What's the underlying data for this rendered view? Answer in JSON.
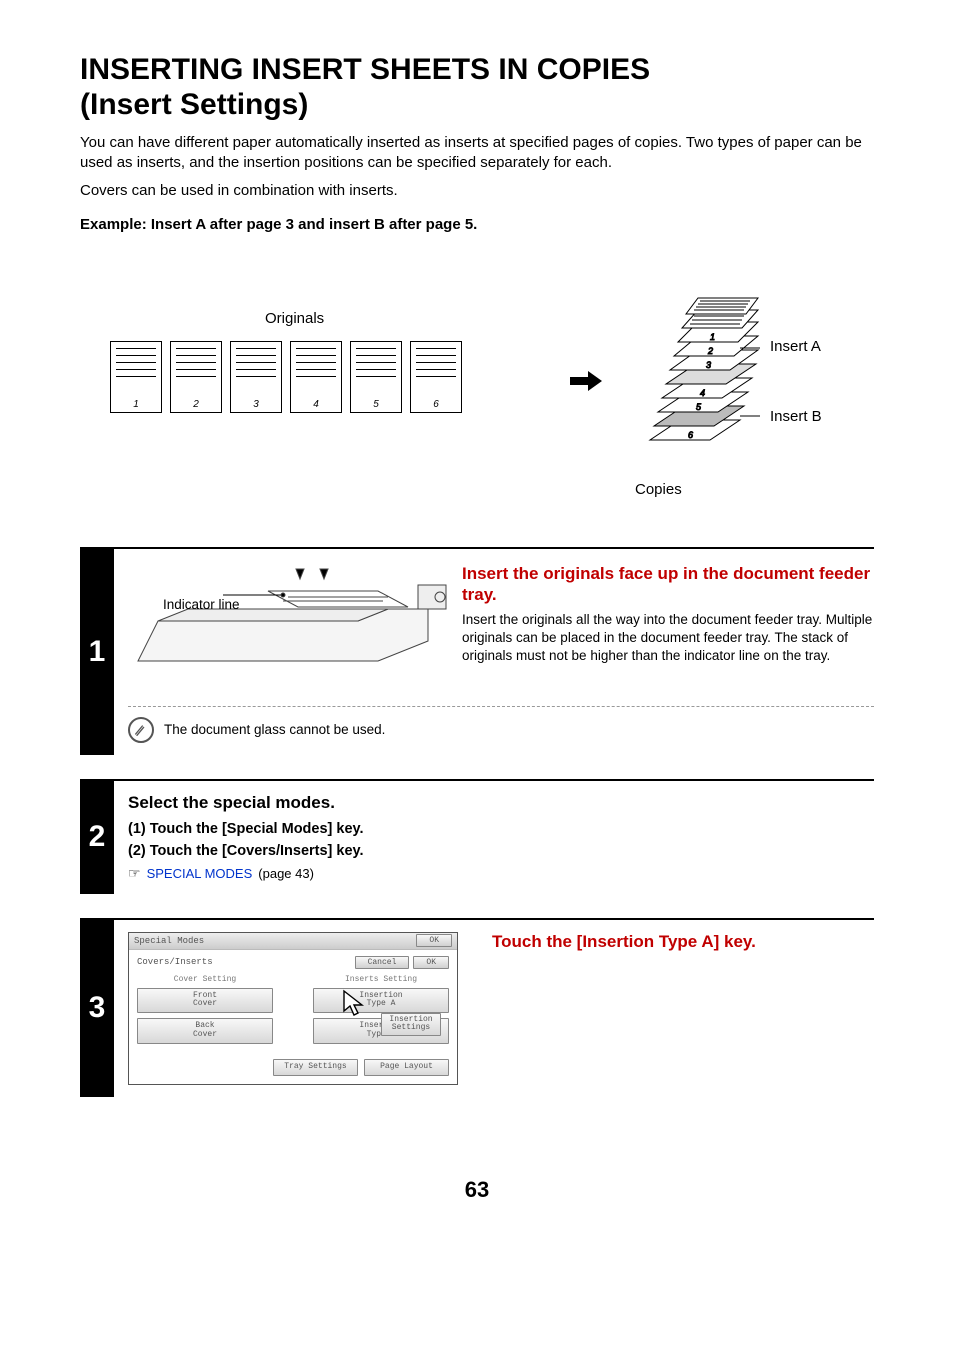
{
  "title_line1": "INSERTING INSERT SHEETS IN COPIES",
  "title_line2": "(Insert Settings)",
  "intro_p1": "You can have different paper automatically inserted as inserts at specified pages of copies. Two types of paper can be used as inserts, and the insertion positions can be specified separately for each.",
  "intro_p2": "Covers can be used in combination with inserts.",
  "example_heading": "Example: Insert A after page 3 and insert B after page 5.",
  "diagram": {
    "originals": "Originals",
    "pages": [
      "1",
      "2",
      "3",
      "4",
      "5",
      "6"
    ],
    "insertA": "Insert A",
    "insertB": "Insert B",
    "copies": "Copies"
  },
  "steps": {
    "s1": {
      "num": "1",
      "indicator": "Indicator line",
      "heading": "Insert the originals face up in the document feeder tray.",
      "body": "Insert the originals all the way into the document feeder tray. Multiple originals can be placed in the document feeder tray. The stack of originals must not be higher than the indicator line on the tray.",
      "note": "The document glass cannot be used."
    },
    "s2": {
      "num": "2",
      "heading": "Select the special modes.",
      "sub1": "(1)  Touch the [Special Modes] key.",
      "sub2": "(2)  Touch the [Covers/Inserts] key.",
      "ref_icon": "☞",
      "ref_link": "SPECIAL MODES",
      "ref_tail": " (page 43)"
    },
    "s3": {
      "num": "3",
      "heading": "Touch the [Insertion Type A] key.",
      "panel": {
        "topbar_title": "Special Modes",
        "topbar_ok": "OK",
        "subbar_title": "Covers/Inserts",
        "subbar_cancel": "Cancel",
        "subbar_ok": "OK",
        "left_h": "Cover Setting",
        "right_h": "Inserts Setting",
        "front": "Front\nCover",
        "back": "Back\nCover",
        "typeA": "Insertion\nType A",
        "typeB": "Insertion\nType B",
        "ins_set": "Insertion\nSettings",
        "tray": "Tray Settings",
        "layout": "Page Layout"
      }
    }
  },
  "page_number": "63"
}
